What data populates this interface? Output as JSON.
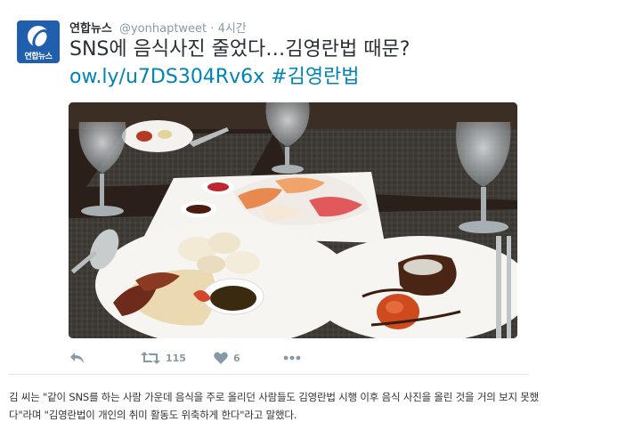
{
  "tweet": {
    "avatar_text": "연합뉴스",
    "display_name": "연합뉴스",
    "handle": "@yonhaptweet",
    "separator": "·",
    "time": "4시간",
    "text_line1": "SNS에 음식사진 줄었다…김영란법 때문?",
    "link_url": "ow.ly/u7DS304Rv6x",
    "hashtag": "#김영란법",
    "actions": {
      "reply_icon": "reply-icon",
      "retweet_icon": "retweet-icon",
      "retweet_count": "115",
      "like_icon": "heart-icon",
      "like_count": "6",
      "more_icon": "more-icon"
    }
  },
  "colors": {
    "link": "#0084b4",
    "muted": "#8899a6",
    "brand": "#1f5fae"
  },
  "caption": {
    "line1": "김 씨는 \"같이 SNS를 하는 사람 가운데 음식을 주로 올리던 사람들도 김영란법 시행 이후 음식 사진을 올린 것을 거의 보지 못했",
    "line2": "다\"라며 \"김영란법이 개인의 취미 활동도 위축하게 한다\"라고 말했다."
  }
}
